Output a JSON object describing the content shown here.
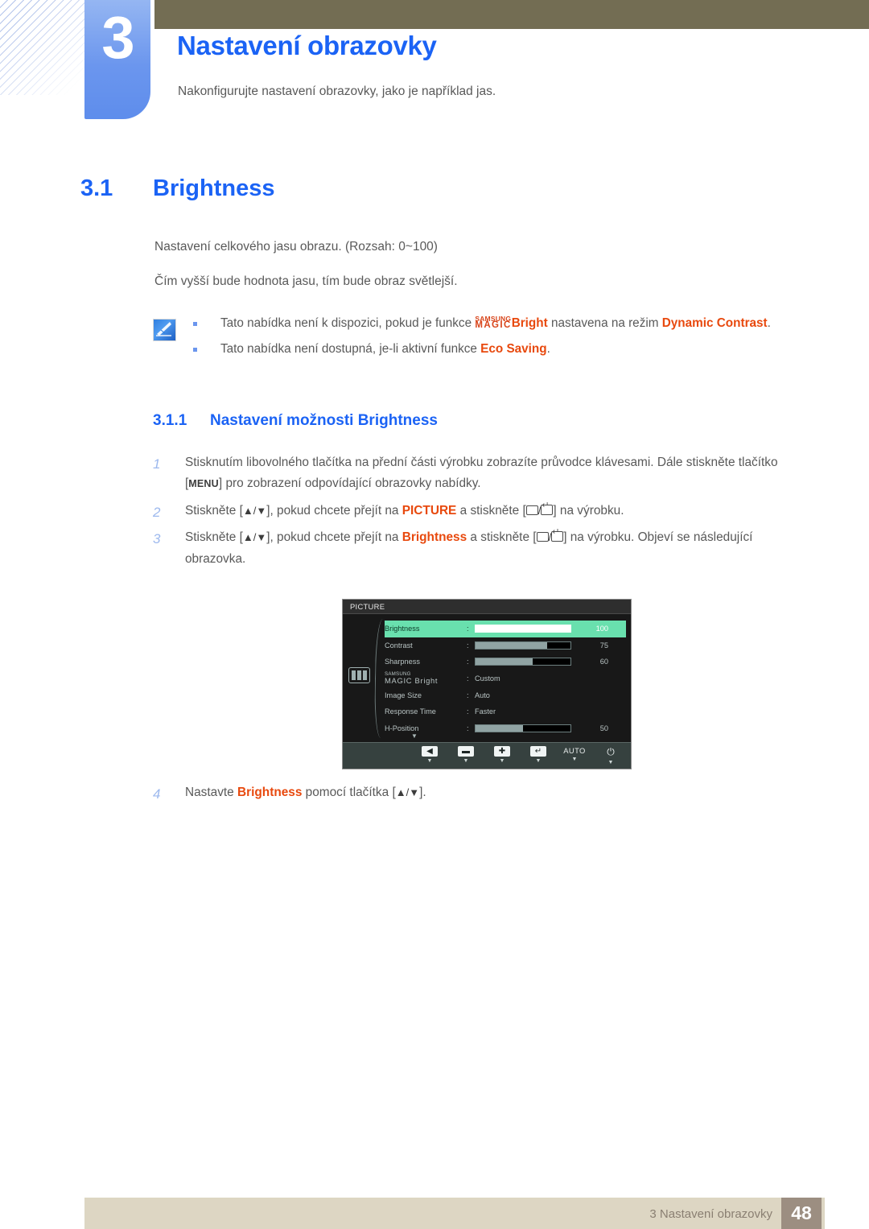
{
  "chapter": {
    "number": "3",
    "title": "Nastavení obrazovky",
    "subtitle": "Nakonfigurujte nastavení obrazovky, jako je například jas."
  },
  "section": {
    "number": "3.1",
    "title": "Brightness",
    "paragraph1": "Nastavení celkového jasu obrazu. (Rozsah: 0~100)",
    "paragraph2": "Čím vyšší bude hodnota jasu, tím bude obraz světlejší."
  },
  "note": {
    "icon": "note-pencil-icon",
    "bullet1": {
      "before_logo": "Tato nabídka není k dispozici, pokud je funkce ",
      "logo_line1": "SAMSUNG",
      "logo_line2": "MAGIC",
      "logo_suffix": "Bright",
      "after_logo": " nastavena na režim ",
      "highlight": "Dynamic Contrast",
      "tail": "."
    },
    "bullet2": {
      "before": "Tato nabídka není dostupná, je-li aktivní funkce ",
      "highlight": "Eco Saving",
      "tail": "."
    }
  },
  "subsection": {
    "number": "3.1.1",
    "title": "Nastavení možnosti Brightness"
  },
  "steps": [
    {
      "num": "1",
      "part1": "Stisknutím libovolného tlačítka na přední části výrobku zobrazíte průvodce klávesami. Dále stiskněte tlačítko [",
      "key": "MENU",
      "part2": "] pro zobrazení odpovídající obrazovky nabídky."
    },
    {
      "num": "2",
      "part1": "Stiskněte [",
      "keys": "▲/▼",
      "part2": "], pokud chcete přejít na ",
      "highlight": "PICTURE",
      "part3": " a stiskněte [",
      "part4": "] na výrobku."
    },
    {
      "num": "3",
      "part1": "Stiskněte [",
      "keys": "▲/▼",
      "part2": "], pokud chcete přejít na ",
      "highlight": "Brightness",
      "part3": " a stiskněte [",
      "part4": "] na výrobku. Objeví se následující obrazovka."
    },
    {
      "num": "4",
      "part1": "Nastavte ",
      "highlight": "Brightness",
      "part2": " pomocí tlačítka [",
      "keys": "▲/▼",
      "part3": "]."
    }
  ],
  "osd": {
    "title": "PICTURE",
    "left_icon": "picture-menu-icon",
    "rows": [
      {
        "label": "Brightness",
        "colon": ":",
        "type": "bar",
        "value": "100",
        "fill": 100,
        "active": true
      },
      {
        "label": "Contrast",
        "colon": ":",
        "type": "bar",
        "value": "75",
        "fill": 75,
        "active": false
      },
      {
        "label": "Sharpness",
        "colon": ":",
        "type": "bar",
        "value": "60",
        "fill": 60,
        "active": false
      },
      {
        "label": "MAGIC Bright",
        "colon": ":",
        "type": "text",
        "value": "Custom",
        "logo_line1": "SAMSUNG",
        "logo_line2": "MAGIC",
        "logo_suffix": " Bright",
        "active": false
      },
      {
        "label": "Image Size",
        "colon": ":",
        "type": "text",
        "value": "Auto",
        "active": false
      },
      {
        "label": "Response Time",
        "colon": ":",
        "type": "text",
        "value": "Faster",
        "active": false
      },
      {
        "label": "H-Position",
        "colon": ":",
        "type": "bar",
        "value": "50",
        "fill": 50,
        "active": false
      }
    ],
    "scroll_indicator": "▼",
    "buttons": [
      {
        "name": "back-button",
        "glyph": "◀",
        "kind": "glyph",
        "tick": "▼"
      },
      {
        "name": "minus-button",
        "glyph": "▬",
        "kind": "glyph",
        "tick": "▼"
      },
      {
        "name": "plus-button",
        "glyph": "✚",
        "kind": "glyph",
        "tick": "▼"
      },
      {
        "name": "enter-button",
        "glyph": "↵",
        "kind": "glyph",
        "tick": "▼"
      },
      {
        "name": "auto-button",
        "glyph": "AUTO",
        "kind": "text",
        "tick": "▼"
      },
      {
        "name": "power-button",
        "glyph": "⏻",
        "kind": "power",
        "tick": "▼"
      }
    ]
  },
  "footer": {
    "text": "3 Nastavení obrazovky",
    "page": "48"
  },
  "colors": {
    "accent_blue": "#1b63f5",
    "tab_blue": "#6b96ee",
    "highlight_orange": "#e8490e",
    "olive": "#736d53",
    "footer_beige": "#ddd6c3",
    "footer_brown": "#9c8e81",
    "osd_green": "#69e0ae"
  }
}
